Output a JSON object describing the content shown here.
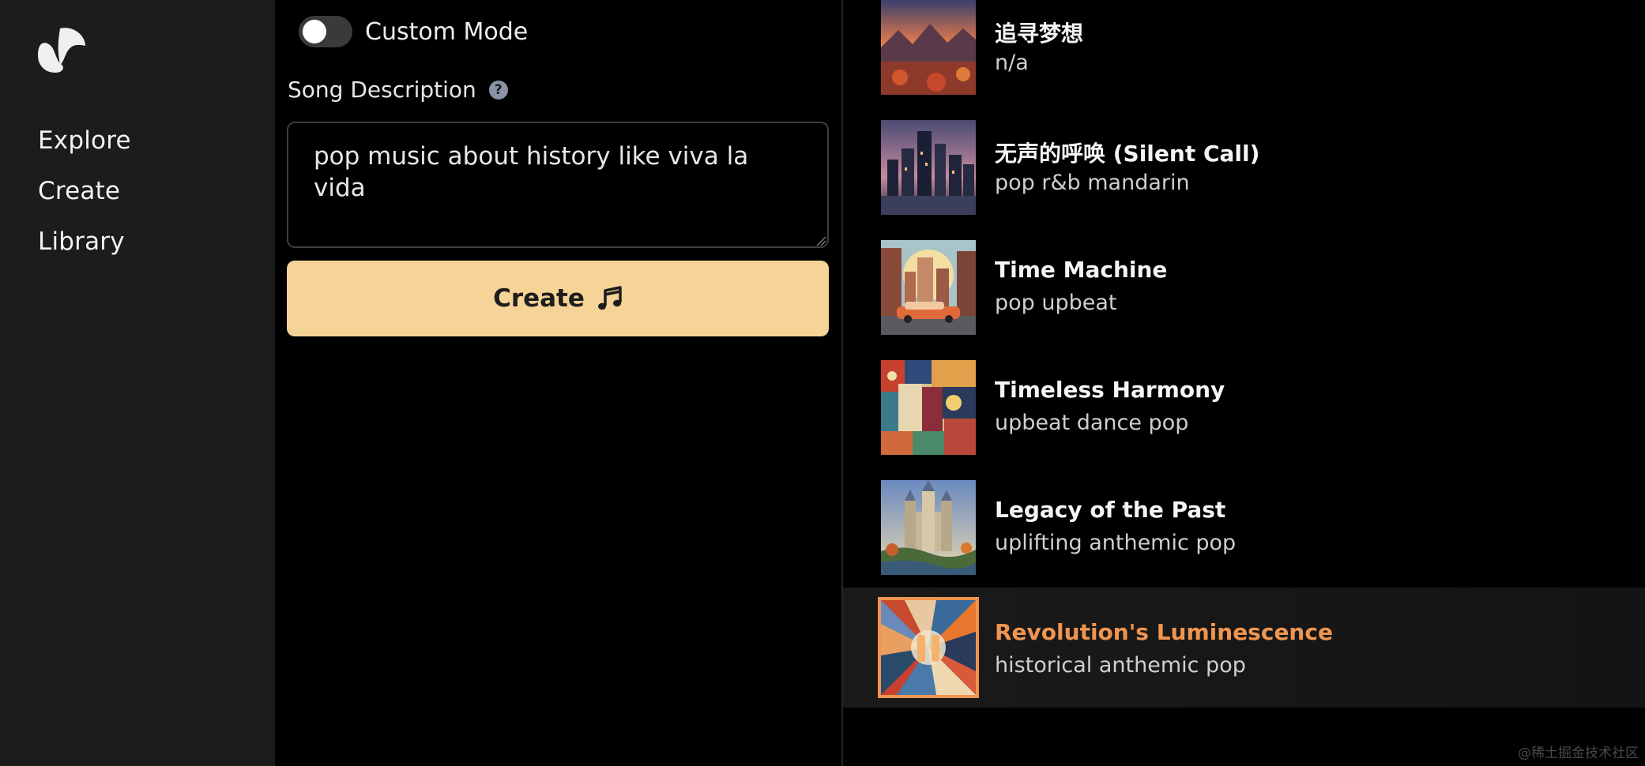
{
  "sidebar": {
    "logo_icon": "suno-wave-logo-icon",
    "items": [
      {
        "label": "Explore"
      },
      {
        "label": "Create"
      },
      {
        "label": "Library"
      }
    ]
  },
  "create": {
    "custom_mode_label": "Custom Mode",
    "custom_mode_on": false,
    "description_label": "Song Description",
    "help_icon": "question-circle-icon",
    "description_value": "pop music about history like viva la vida",
    "create_button_label": "Create",
    "create_button_icon": "music-note-icon"
  },
  "songs": [
    {
      "title": "追寻梦想",
      "tags": "n/a"
    },
    {
      "title": "无声的呼唤 (Silent Call)",
      "tags": "pop r&b mandarin"
    },
    {
      "title": "Time Machine",
      "tags": "pop upbeat"
    },
    {
      "title": "Timeless Harmony",
      "tags": "upbeat dance pop"
    },
    {
      "title": "Legacy of the Past",
      "tags": "uplifting anthemic pop"
    },
    {
      "title": "Revolution's Luminescence",
      "tags": "historical anthemic pop",
      "playing": true
    }
  ],
  "colors": {
    "accent": "#f0954f",
    "create_button": "#f6d396",
    "sidebar_bg": "#1c1c1c"
  },
  "watermark": "@稀土掘金技术社区"
}
